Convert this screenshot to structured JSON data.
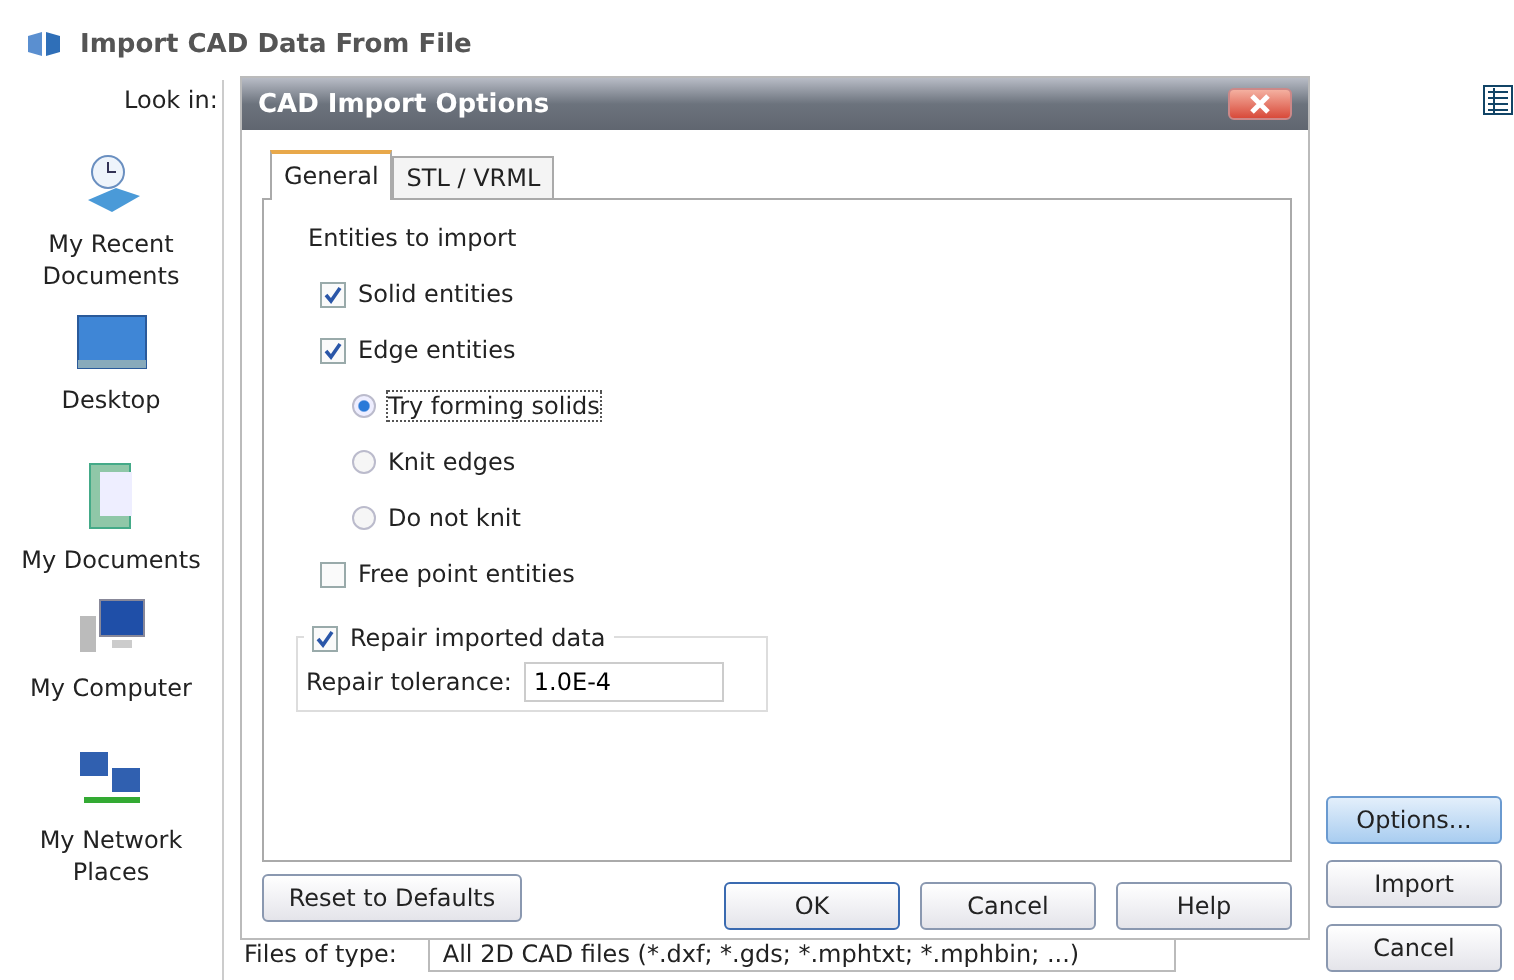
{
  "window": {
    "title": "Import CAD Data From File"
  },
  "look_in": {
    "label": "Look in:"
  },
  "places": [
    {
      "kind": "recent",
      "label": "My Recent Documents"
    },
    {
      "kind": "desktop",
      "label": "Desktop"
    },
    {
      "kind": "documents",
      "label": "My Documents"
    },
    {
      "kind": "computer",
      "label": "My Computer"
    },
    {
      "kind": "network",
      "label": "My Network Places"
    }
  ],
  "files_of_type": {
    "label": "Files of type:",
    "value": "All 2D CAD files (*.dxf; *.gds; *.mphtxt; *.mphbin; ...)"
  },
  "buttons": [
    "Options...",
    "Import",
    "Cancel"
  ],
  "options_dialog": {
    "title": "CAD Import Options",
    "tabs": [
      {
        "label": "General",
        "selected": true
      },
      {
        "label": "STL / VRML",
        "selected": false
      }
    ],
    "section_label": "Entities to import",
    "options": [
      {
        "kind": "checkbox",
        "label": "Solid entities",
        "checked": true
      },
      {
        "kind": "checkbox",
        "label": "Edge entities",
        "checked": true
      },
      {
        "kind": "radio",
        "label": "Try forming solids",
        "selected": true
      },
      {
        "kind": "radio",
        "label": "Knit edges",
        "selected": false
      },
      {
        "kind": "radio",
        "label": "Do not knit",
        "selected": false
      },
      {
        "kind": "checkbox",
        "label": "Free point entities",
        "checked": false
      }
    ],
    "repair": {
      "label": "Repair imported data",
      "checked": true,
      "tolerance_label": "Repair tolerance:",
      "tolerance_value": "1.0E-4"
    },
    "reset_button": "Reset to Defaults",
    "buttons": [
      "OK",
      "Cancel",
      "Help"
    ]
  }
}
